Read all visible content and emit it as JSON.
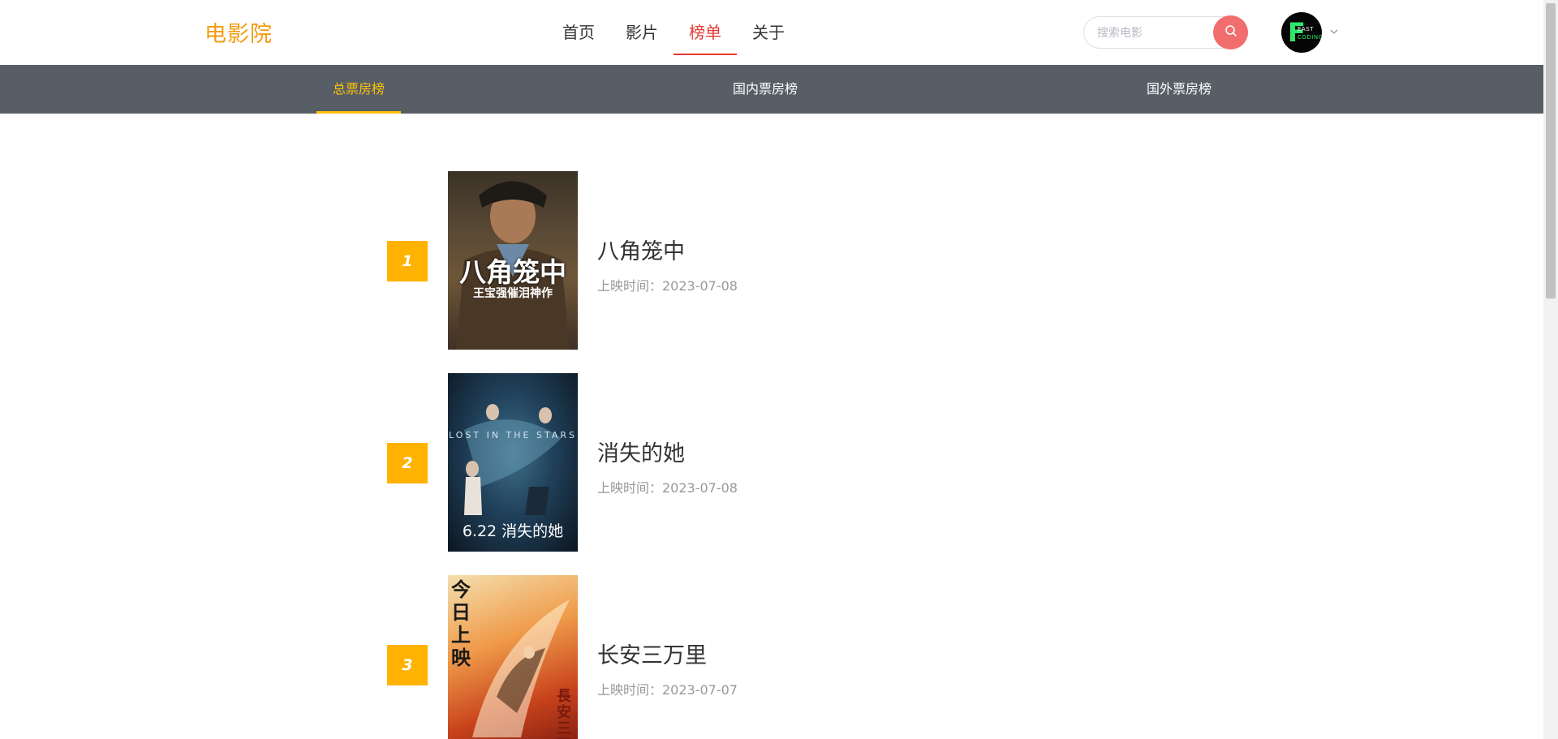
{
  "header": {
    "logo": "电影院",
    "nav": [
      {
        "label": "首页",
        "active": false
      },
      {
        "label": "影片",
        "active": false
      },
      {
        "label": "榜单",
        "active": true
      },
      {
        "label": "关于",
        "active": false
      }
    ],
    "search": {
      "placeholder": "搜索电影",
      "value": ""
    },
    "avatar": {
      "letter": "F",
      "line1": "EAST",
      "line2": "CODING"
    }
  },
  "subnav": {
    "tabs": [
      {
        "label": "总票房榜",
        "active": true
      },
      {
        "label": "国内票房榜",
        "active": false
      },
      {
        "label": "国外票房榜",
        "active": false
      }
    ]
  },
  "movies": [
    {
      "rank": "1",
      "title": "八角笼中",
      "release": "上映时间：2023-07-08",
      "poster_text": "八角笼中",
      "poster_sub": "王宝强催泪神作"
    },
    {
      "rank": "2",
      "title": "消失的她",
      "release": "上映时间：2023-07-08",
      "poster_text": "6.22 消失的她",
      "poster_sub": "LOST IN THE STARS"
    },
    {
      "rank": "3",
      "title": "长安三万里",
      "release": "上映时间：2023-07-07",
      "poster_text": "今日上映",
      "poster_sub": "長安三万里"
    }
  ],
  "colors": {
    "brand": "#f39c12",
    "nav_active": "#e53935",
    "subnav_bg": "#575e66",
    "tab_active": "#ffc107",
    "rank_bg": "#ffb300",
    "search_btn": "#f26d6d"
  }
}
